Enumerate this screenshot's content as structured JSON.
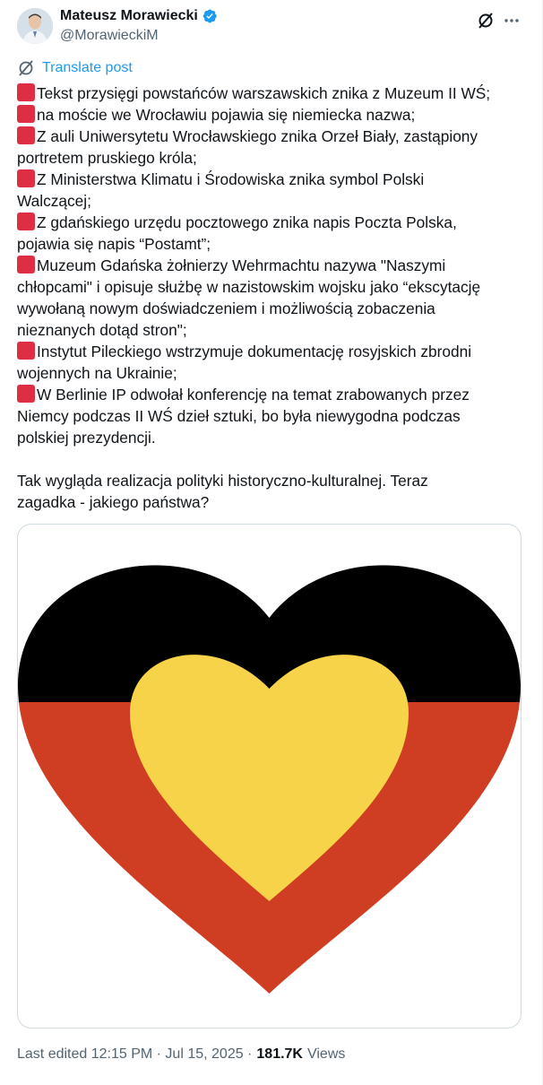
{
  "author": {
    "name": "Mateusz Morawiecki",
    "handle": "@MorawieckiM"
  },
  "actions": {
    "grok_icon": "grok-icon",
    "more_icon": "more-options-icon"
  },
  "translate_label": "Translate post",
  "post": {
    "lines": [
      {
        "bullet": true,
        "text": "Tekst przysięgi powstańców warszawskich znika z Muzeum II WŚ;"
      },
      {
        "bullet": true,
        "text": "na moście we Wrocławiu pojawia się niemiecka nazwa;"
      },
      {
        "bullet": true,
        "text": "Z auli Uniwersytetu Wrocławskiego znika Orzeł Biały, zastąpiony"
      },
      {
        "bullet": false,
        "text": "portretem pruskiego króla;"
      },
      {
        "bullet": true,
        "text": "Z Ministerstwa Klimatu i Środowiska znika symbol Polski"
      },
      {
        "bullet": false,
        "text": "Walczącej;"
      },
      {
        "bullet": true,
        "text": "Z gdańskiego urzędu pocztowego znika napis Poczta Polska,"
      },
      {
        "bullet": false,
        "text": "pojawia się napis “Postamt”;"
      },
      {
        "bullet": true,
        "text": "Muzeum Gdańska żołnierzy Wehrmachtu nazywa \"Naszymi"
      },
      {
        "bullet": false,
        "text": "chłopcami\" i opisuje służbę w nazistowskim wojsku jako “ekscytację"
      },
      {
        "bullet": false,
        "text": "wywołaną nowym doświadczeniem i możliwością zobaczenia"
      },
      {
        "bullet": false,
        "text": "nieznanych dotąd stron\";"
      },
      {
        "bullet": true,
        "text": "Instytut Pileckiego wstrzymuje dokumentację rosyjskich zbrodni"
      },
      {
        "bullet": false,
        "text": "wojennych na Ukrainie;"
      },
      {
        "bullet": true,
        "text": "W Berlinie IP odwołał konferencję na temat zrabowanych przez"
      },
      {
        "bullet": false,
        "text": "Niemcy podczas II WŚ dzieł sztuki, bo była niewygodna podczas"
      },
      {
        "bullet": false,
        "text": "polskiej prezydencji."
      },
      {
        "bullet": false,
        "text": ""
      },
      {
        "bullet": false,
        "text": "Tak wygląda realizacja polityki historyczno-kulturalnej. Teraz"
      },
      {
        "bullet": false,
        "text": "zagadka - jakiego państwa?"
      }
    ]
  },
  "media": {
    "colors": {
      "black": "#000000",
      "red": "#cf3d23",
      "gold": "#f6d348"
    }
  },
  "meta": {
    "edited": "Last edited 12:15 PM · Jul 15, 2025 ·",
    "views_count": "181.7K",
    "views_label": "Views"
  },
  "colors": {
    "accent": "#1d9bf0",
    "bullet": "#dd2e44",
    "secondary_text": "#536471"
  }
}
